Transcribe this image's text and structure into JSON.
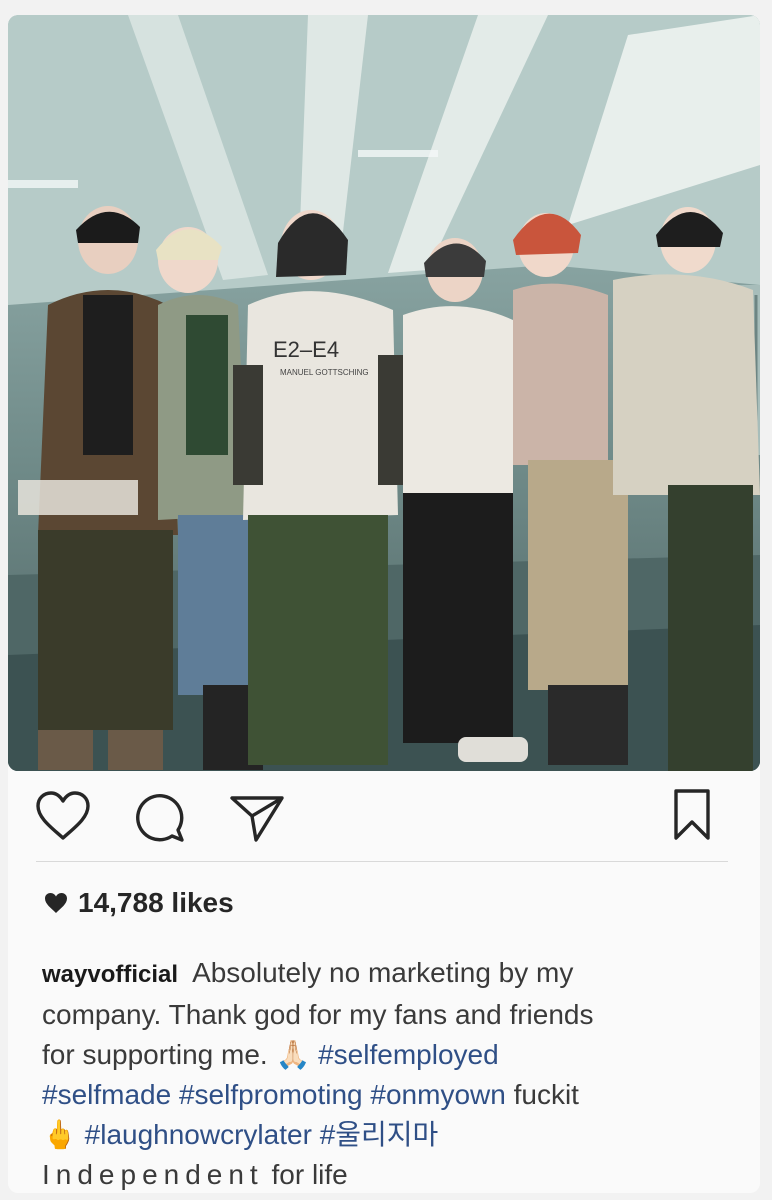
{
  "post": {
    "likes": "14,788 likes",
    "username": "wayvofficial",
    "caption_lines": [
      "Absolutely no marketing by my",
      "company. Thank god for my fans and friends",
      "for supporting me.",
      "fuckit"
    ],
    "emoji_pray": "🙏🏻",
    "emoji_hand": "🖕",
    "hashtags": [
      "#selfemployed",
      "#selfmade",
      "#selfpromoting",
      "#onmyown",
      "#laughnowcrylater",
      "#울리지마"
    ],
    "last_line_a": "Independent",
    "last_line_b": "for life",
    "photo_text": {
      "shirt_main": "E2–E4",
      "shirt_sub": "MANUEL GOTTSCHING"
    }
  },
  "icons": [
    "heart-icon",
    "comment-icon",
    "share-icon",
    "bookmark-icon",
    "likes-heart-icon"
  ],
  "colors": {
    "text": "#262626",
    "hashtag": "#2f4f86",
    "background": "#fafafa"
  }
}
